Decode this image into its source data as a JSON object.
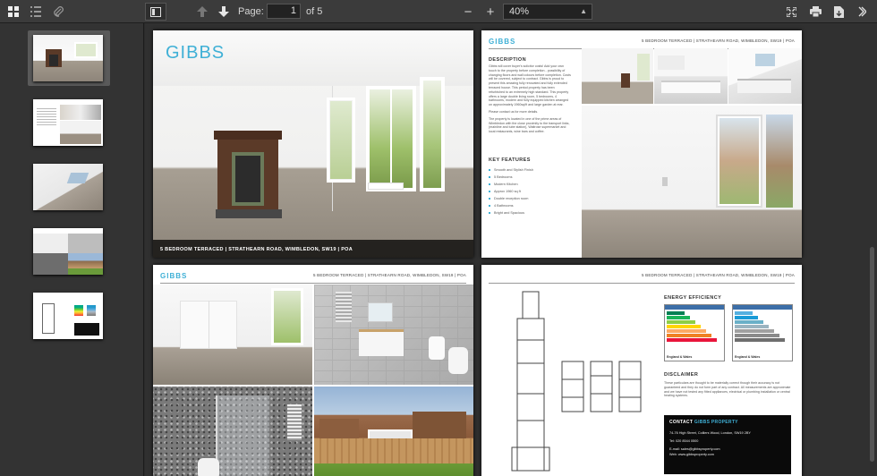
{
  "toolbar": {
    "page_label": "Page:",
    "current_page": "1",
    "of_total": "of 5",
    "zoom_minus": "−",
    "zoom_plus": "+",
    "zoom_value": "40%"
  },
  "icons": {
    "grid": "grid-view-icon",
    "list": "outline-icon",
    "attach": "attachments-icon",
    "sidebar": "sidebar-toggle-icon",
    "prev": "arrow-up-icon",
    "next": "arrow-down-icon",
    "fullscreen": "fullscreen-icon",
    "print": "print-icon",
    "download": "download-icon",
    "more": "more-icon"
  },
  "thumbnails": [
    {
      "label": "page-1"
    },
    {
      "label": "page-2"
    },
    {
      "label": "page-3"
    },
    {
      "label": "page-4"
    },
    {
      "label": "page-5"
    }
  ],
  "brochure": {
    "logo": "GIBBS",
    "caption": "5 BEDROOM TERRACED  |  STRATHEARN ROAD, WIMBLEDON, SW19  |  POA",
    "header_text": "5 BEDROOM TERRACED  |  STRATHEARN ROAD, WIMBLEDON, SW19  |  POA",
    "description_title": "DESCRIPTION",
    "description_1": "Gibbs will cover buyer's solicitor costs! Add your own touch to the property before completion - possibility of changing floors and wall colours before completion. Costs will be covered, subject to contract. Gibbs is proud to present this amazing fully renovated and fully extended terraced house. This period property has been refurbished to an extremely high standard. This property offers a large double living room, 5 bedrooms, 4 bathrooms, modern and fully equipped kitchen arranged on approximately 1960sq/ft and large garden at rear.",
    "description_2": "Please contact us for more details.",
    "description_3": "The property is located in one of the prime areas of Wimbledon with the close proximity to the transport links, (mainline and tube station), Waitrose supermarket and local restaurants, wine bars and coffee.",
    "key_features_title": "KEY FEATURES",
    "key_features": [
      "Smooth and Stylish Finish",
      "5 Bedrooms",
      "Modern Kitchen",
      "Approx 1960 sq ft",
      "Double reception room",
      "4 Bathrooms",
      "Bright and Spacious"
    ],
    "energy_title": "ENERGY EFFICIENCY",
    "epc_left_footer": "England & Wales",
    "epc_right_footer": "England & Wales",
    "disclaimer_title": "DISCLAIMER",
    "disclaimer": "These particulars are thought to be materially correct though their accuracy is not guaranteed and they do not form part of any contract. All measurements are approximate and we have not tested any fitted appliances, electrical or plumbing installation or central heating systems.",
    "contact_label": "CONTACT",
    "contact_name": "GIBBS PROPERTY",
    "contact_address": "74-76 High Street, Colliers Wood, London, SW19 2BY",
    "contact_tel": "Tel: 020 8544 0500",
    "contact_email": "E-mail: sales@gibbsproperty.com",
    "contact_web": "Web: www.gibbsproperty.com"
  },
  "colors": {
    "accent": "#3fb0d6",
    "toolbar_bg": "#3b3b3b",
    "viewer_bg": "#303030"
  }
}
